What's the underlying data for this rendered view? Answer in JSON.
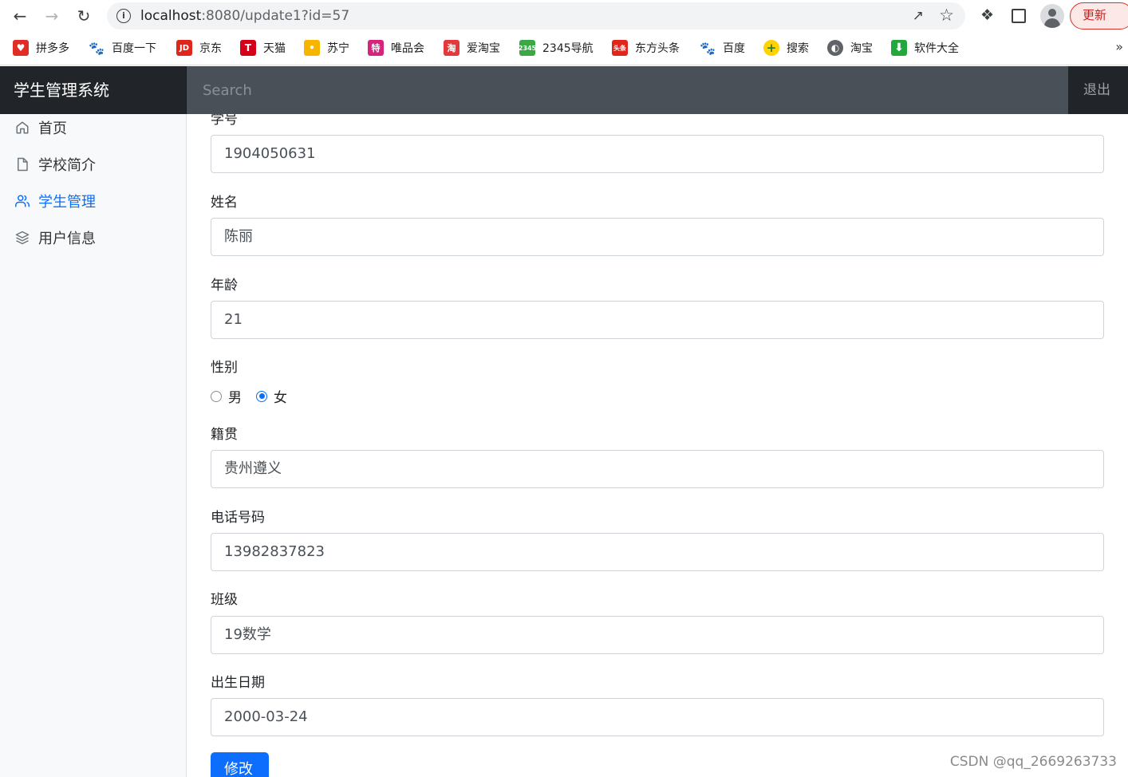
{
  "browser": {
    "url_host": "localhost",
    "url_rest": ":8080/update1?id=57",
    "update_label": "更新",
    "bookmarks": [
      {
        "label": "拼多多",
        "color": "#e02e24"
      },
      {
        "label": "百度一下",
        "color": "#2932e1"
      },
      {
        "label": "京东",
        "color": "#e1251b"
      },
      {
        "label": "天猫",
        "color": "#d4001a"
      },
      {
        "label": "苏宁",
        "color": "#f7b500"
      },
      {
        "label": "唯品会",
        "color": "#d8237d"
      },
      {
        "label": "爱淘宝",
        "color": "#e4393c"
      },
      {
        "label": "2345导航",
        "color": "#3aa845"
      },
      {
        "label": "东方头条",
        "color": "#e1251b"
      },
      {
        "label": "百度",
        "color": "#2932e1"
      },
      {
        "label": "搜索",
        "color": "#4caf50"
      },
      {
        "label": "淘宝",
        "color": "#5f6368"
      },
      {
        "label": "软件大全",
        "color": "#23a83e"
      }
    ],
    "more": "»"
  },
  "app": {
    "brand": "学生管理系统",
    "search_placeholder": "Search",
    "signout": "退出"
  },
  "sidebar": {
    "items": [
      {
        "label": "首页",
        "icon": "home-icon"
      },
      {
        "label": "学校简介",
        "icon": "file-icon"
      },
      {
        "label": "学生管理",
        "icon": "users-icon",
        "active": true
      },
      {
        "label": "用户信息",
        "icon": "layers-icon"
      }
    ]
  },
  "form": {
    "student_id_label": "学号",
    "student_id": "1904050631",
    "name_label": "姓名",
    "name": "陈丽",
    "age_label": "年龄",
    "age": "21",
    "gender_label": "性别",
    "gender_male": "男",
    "gender_female": "女",
    "gender_selected": "女",
    "hometown_label": "籍贯",
    "hometown": "贵州遵义",
    "phone_label": "电话号码",
    "phone": "13982837823",
    "class_label": "班级",
    "class": "19数学",
    "birth_label": "出生日期",
    "birth": "2000-03-24",
    "submit_label": "修改"
  },
  "watermark": "CSDN @qq_2669263733"
}
